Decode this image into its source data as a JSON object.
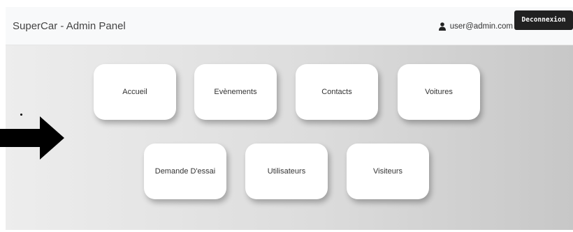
{
  "navbar": {
    "brand": "SuperCar - Admin Panel",
    "user_email": "user@admin.com",
    "logout_label": "Deconnexion"
  },
  "dashboard": {
    "cards": [
      {
        "label": "Accueil"
      },
      {
        "label": "Evènements"
      },
      {
        "label": "Contacts"
      },
      {
        "label": "Voitures"
      },
      {
        "label": "Demande D'essai"
      },
      {
        "label": "Utilisateurs"
      },
      {
        "label": "Visiteurs"
      }
    ]
  },
  "icons": {
    "user": "user-icon",
    "arrow": "arrow-right-icon"
  },
  "colors": {
    "navbar_bg": "#f8f9fa",
    "logout_bg": "#212121",
    "card_bg": "#ffffff"
  }
}
